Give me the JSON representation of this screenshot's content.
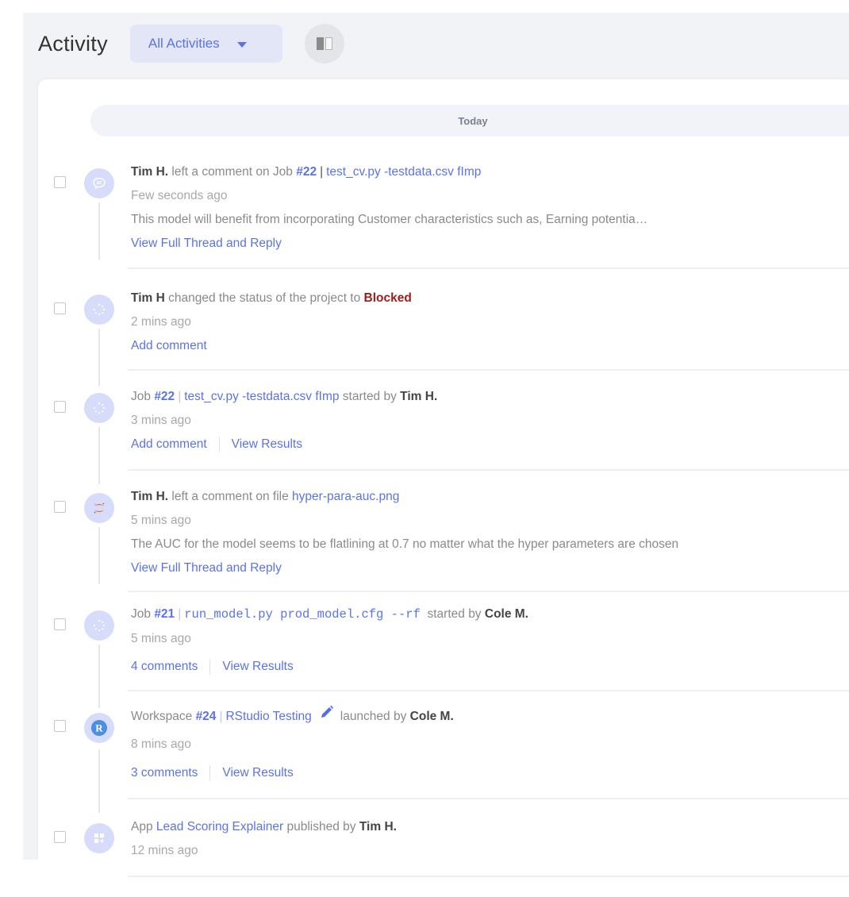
{
  "header": {
    "title": "Activity",
    "filter": {
      "selected": "All Activities",
      "icon": "caret-down-icon"
    },
    "layout_toggle_icon": "split-view-icon"
  },
  "day_separator": "Today",
  "colors": {
    "accent": "#5b73e8",
    "blocked": "#9b1c1c",
    "avatar_bg": "#d6dcfa",
    "page_bg": "#f2f3f6"
  },
  "activities": [
    {
      "icon": "comment-icon",
      "actor": "Tim H.",
      "verb": "left a comment on Job",
      "job_number": "#22",
      "separator": "|",
      "target": "test_cv.py -testdata.csv fImp",
      "time": "Few seconds ago",
      "comment": "This model will benefit from incorporating Customer characteristics such as, Earning potentia…",
      "actions": [
        "View Full Thread and Reply"
      ]
    },
    {
      "icon": "spinner-icon",
      "actor": "Tim H",
      "verb": "changed the status of the project to",
      "status": "Blocked",
      "time": "2 mins ago",
      "actions": [
        "Add comment"
      ]
    },
    {
      "icon": "spinner-icon",
      "prefix": "Job",
      "job_number": "#22",
      "separator": "|",
      "target": "test_cv.py -testdata.csv fImp",
      "verb": "started by",
      "actor": "Tim H.",
      "time": "3 mins ago",
      "actions": [
        "Add comment",
        "View Results"
      ]
    },
    {
      "icon": "jupyter-icon",
      "actor": "Tim H.",
      "verb": "left a comment on file",
      "target": "hyper-para-auc.png",
      "time": "5 mins ago",
      "comment": "The AUC for the model seems to be flatlining at 0.7 no matter what the hyper parameters are chosen",
      "actions": [
        "View Full Thread and Reply"
      ]
    },
    {
      "icon": "spinner-icon",
      "prefix": "Job",
      "job_number": "#21",
      "separator": "|",
      "target": "run_model.py prod_model.cfg --rf",
      "verb": "started by",
      "actor": "Cole M.",
      "time": "5 mins ago",
      "actions": [
        "4 comments",
        "View Results"
      ]
    },
    {
      "icon": "rstudio-icon",
      "prefix": "Workspace",
      "job_number": "#24",
      "separator": "|",
      "target": "RStudio Testing",
      "edit_icon": "pencil-icon",
      "verb": "launched by",
      "actor": "Cole M.",
      "time": "8 mins ago",
      "actions": [
        "3 comments",
        "View Results"
      ]
    },
    {
      "icon": "app-grid-icon",
      "prefix": "App",
      "target": "Lead Scoring Explainer",
      "verb": "published by",
      "actor": "Tim H.",
      "time": "12 mins ago",
      "actions": []
    }
  ]
}
